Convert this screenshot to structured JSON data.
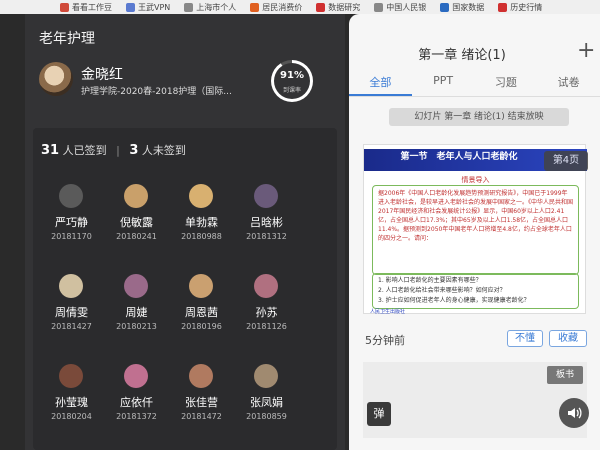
{
  "bookmarks": [
    {
      "label": "看看工作豆",
      "color": "#d04a3a"
    },
    {
      "label": "王武VPN",
      "color": "#5a7ad0"
    },
    {
      "label": "上海市个人",
      "color": "#888888"
    },
    {
      "label": "居民消费价",
      "color": "#e06020"
    },
    {
      "label": "数据研究",
      "color": "#d03030"
    },
    {
      "label": "中国人民银",
      "color": "#888888"
    },
    {
      "label": "国家数据",
      "color": "#2a6ac0"
    },
    {
      "label": "历史行情",
      "color": "#d03030"
    }
  ],
  "left": {
    "course_title": "老年护理",
    "student_name": "金晓红",
    "student_info": "护理学院-2020春-2018护理（国际...",
    "attendance_rate": "91%",
    "attendance_label": "到课率",
    "signed_count": "31",
    "signed_label": "人已签到",
    "unsigned_count": "3",
    "unsigned_label": "人未签到",
    "students": [
      {
        "name": "严巧静",
        "id": "20181170"
      },
      {
        "name": "倪敏露",
        "id": "20180241"
      },
      {
        "name": "单勃霖",
        "id": "20180988"
      },
      {
        "name": "吕晗彬",
        "id": "20181312"
      },
      {
        "name": "周倩雯",
        "id": "20181427"
      },
      {
        "name": "周婕",
        "id": "20180213"
      },
      {
        "name": "周恩茜",
        "id": "20180196"
      },
      {
        "name": "孙苏",
        "id": "20181126"
      },
      {
        "name": "孙莹瑰",
        "id": "20180204"
      },
      {
        "name": "应依仟",
        "id": "20181372"
      },
      {
        "name": "张佳营",
        "id": "20181472"
      },
      {
        "name": "张凤娟",
        "id": "20180859"
      }
    ]
  },
  "right": {
    "chapter_title": "第一章 绪论(1)",
    "plus": "+",
    "tabs": [
      "全部",
      "PPT",
      "习题",
      "试卷"
    ],
    "slide_end_notice": "幻灯片 第一章 绪论(1) 结束放映",
    "slide": {
      "heading": "第一节　老年人与人口老龄化",
      "page": "第4页",
      "subtitle": "情景导入",
      "body": "据2006年《中国人口老龄化发展趋势预测研究报告》，中国已于1999年进入老龄社会，是较早进入老龄社会的发展中国家之一。《中华人民共和国2017年国民经济和社会发展统计公报》显示，中国60岁以上人口2.41亿，占全国总人口17.3%；其中65岁及以上人口1.58亿，占全国总人口11.4%。据预测到2050年中国老年人口将增至4.8亿，约占全球老年人口的四分之一。请问：",
      "q1": "1. 影响人口老龄化的主要因素有哪些？",
      "q2": "2. 人口老龄化给社会带来哪些影响？如何应对？",
      "q3": "3. 护士应如何促进老年人的身心健康，实现健康老龄化？",
      "footer": "人民卫生出版社"
    },
    "time_ago": "5分钟前",
    "btn_budong": "不懂",
    "btn_shoucang": "收藏",
    "board_label": "板书",
    "danmu_label": "弹"
  }
}
